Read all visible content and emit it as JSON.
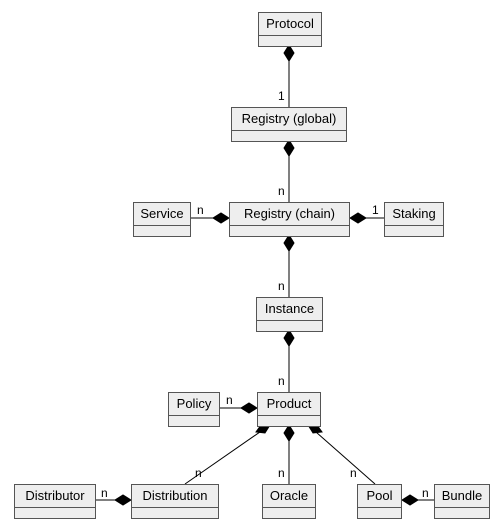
{
  "nodes": {
    "protocol": "Protocol",
    "registryGlobal": "Registry (global)",
    "service": "Service",
    "registryChain": "Registry (chain)",
    "staking": "Staking",
    "instance": "Instance",
    "policy": "Policy",
    "product": "Product",
    "distributor": "Distributor",
    "distribution": "Distribution",
    "oracle": "Oracle",
    "pool": "Pool",
    "bundle": "Bundle"
  },
  "mult": {
    "protocol_registryGlobal": "1",
    "registryGlobal_registryChain": "n",
    "registryChain_service": "n",
    "registryChain_staking": "1",
    "registryChain_instance": "n",
    "instance_product": "n",
    "product_policy": "n",
    "product_distribution": "n",
    "product_oracle": "n",
    "product_pool": "n",
    "distribution_distributor": "n",
    "pool_bundle": "n"
  },
  "chart_data": {
    "type": "diagram",
    "title": "",
    "nodes": [
      "Protocol",
      "Registry (global)",
      "Service",
      "Registry (chain)",
      "Staking",
      "Instance",
      "Policy",
      "Product",
      "Distributor",
      "Distribution",
      "Oracle",
      "Pool",
      "Bundle"
    ],
    "edges": [
      {
        "from": "Protocol",
        "to": "Registry (global)",
        "mult": "1",
        "agg": "composition"
      },
      {
        "from": "Registry (global)",
        "to": "Registry (chain)",
        "mult": "n",
        "agg": "composition"
      },
      {
        "from": "Registry (chain)",
        "to": "Service",
        "mult": "n",
        "agg": "composition"
      },
      {
        "from": "Registry (chain)",
        "to": "Staking",
        "mult": "1",
        "agg": "composition"
      },
      {
        "from": "Registry (chain)",
        "to": "Instance",
        "mult": "n",
        "agg": "composition"
      },
      {
        "from": "Instance",
        "to": "Product",
        "mult": "n",
        "agg": "composition"
      },
      {
        "from": "Product",
        "to": "Policy",
        "mult": "n",
        "agg": "composition"
      },
      {
        "from": "Product",
        "to": "Distribution",
        "mult": "n",
        "agg": "composition"
      },
      {
        "from": "Product",
        "to": "Oracle",
        "mult": "n",
        "agg": "composition"
      },
      {
        "from": "Product",
        "to": "Pool",
        "mult": "n",
        "agg": "composition"
      },
      {
        "from": "Distribution",
        "to": "Distributor",
        "mult": "n",
        "agg": "composition"
      },
      {
        "from": "Pool",
        "to": "Bundle",
        "mult": "n",
        "agg": "composition"
      }
    ]
  }
}
